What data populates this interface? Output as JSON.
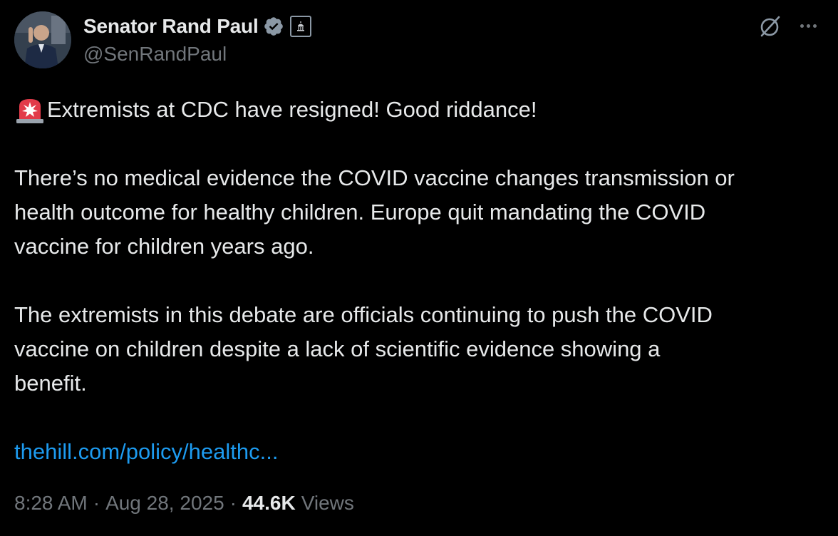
{
  "author": {
    "display_name": "Senator Rand Paul",
    "handle": "@SenRandPaul"
  },
  "icons": {
    "verified": "verified-badge-icon",
    "government": "government-affiliation-icon",
    "grok": "grok-icon",
    "more": "more-options-icon",
    "siren": "police-siren-emoji"
  },
  "tweet": {
    "line1": "Extremists at CDC have resigned! Good riddance!",
    "para2_line1": "There’s no medical evidence the COVID vaccine changes transmission or",
    "para2_line2": "health outcome for healthy children. Europe quit mandating the COVID",
    "para2_line3": "vaccine for children years ago.",
    "para3_line1": "The extremists in this debate are officials continuing to push the COVID",
    "para3_line2": "vaccine on children despite a lack of scientific evidence showing a",
    "para3_line3": "benefit.",
    "link": "thehill.com/policy/healthc..."
  },
  "meta": {
    "time": "8:28 AM",
    "date": "Aug 28, 2025",
    "views_count": "44.6K",
    "views_label": "Views",
    "separator": "·"
  },
  "colors": {
    "background": "#000000",
    "text": "#e7e9ea",
    "secondary": "#71767b",
    "link": "#1d9bf0",
    "verified": "#8b98a5"
  }
}
